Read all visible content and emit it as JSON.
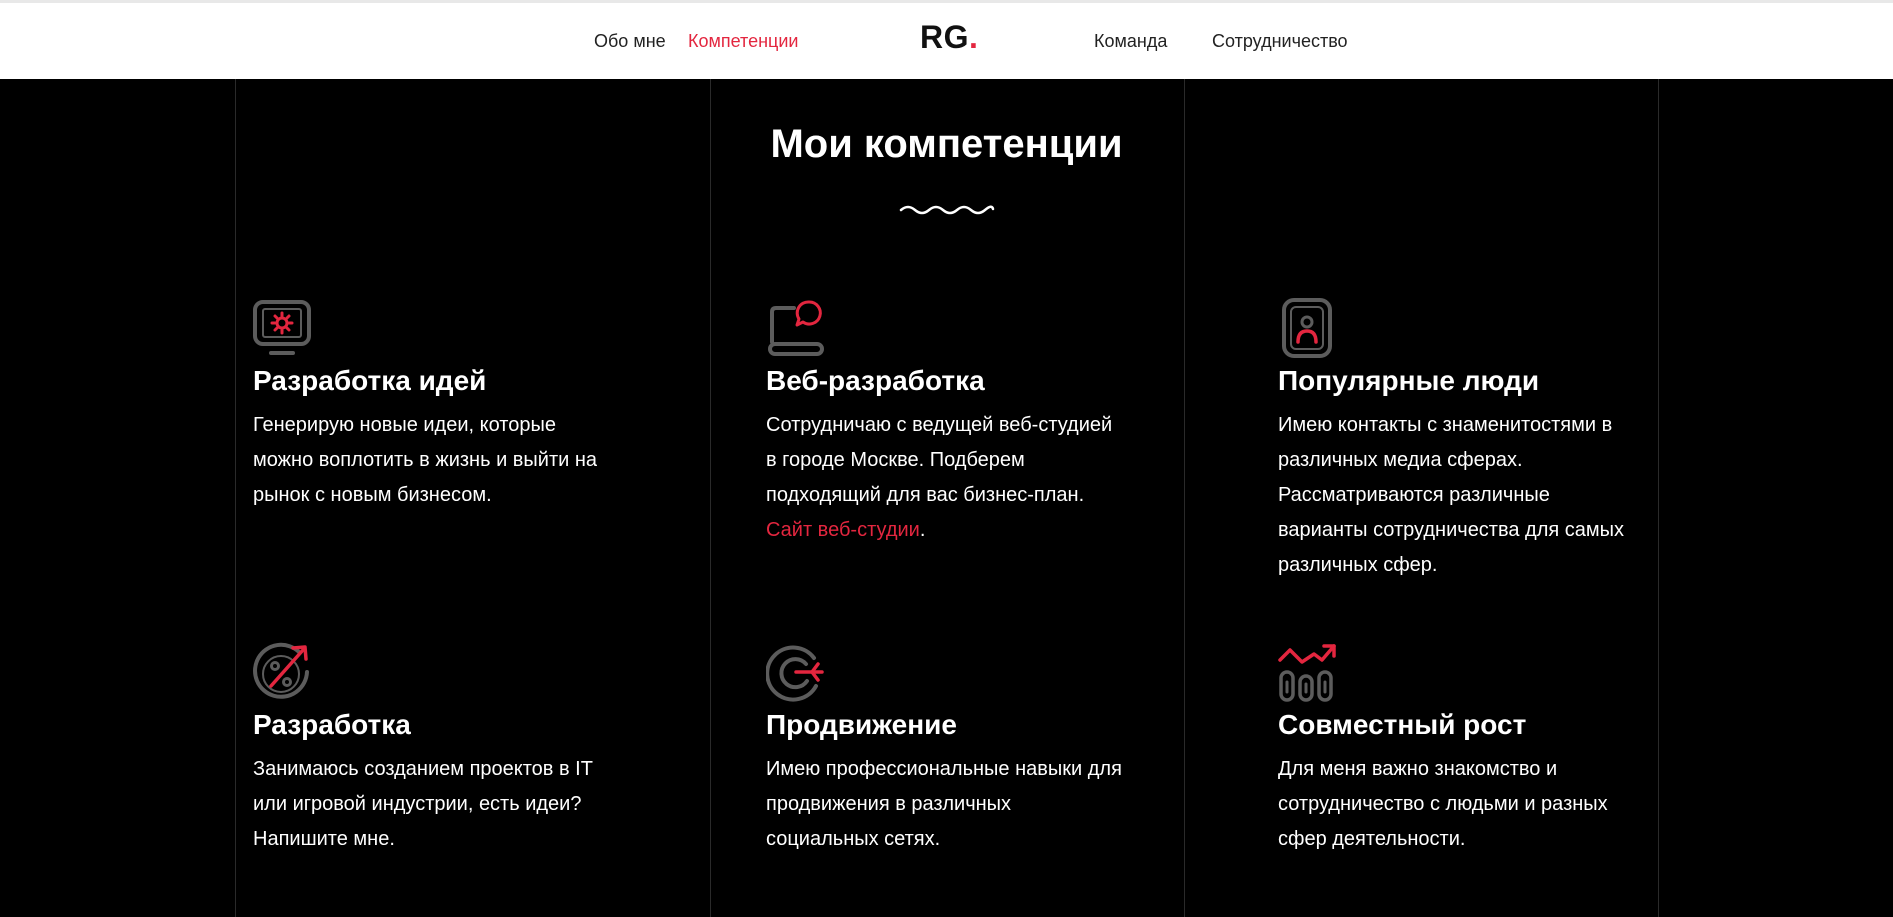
{
  "nav": {
    "about": "Обо мне",
    "competencies": "Компетенции",
    "logo_text": "RG",
    "logo_dot": ".",
    "team": "Команда",
    "cooperation": "Сотрудничество"
  },
  "section": {
    "title": "Мои компетенции"
  },
  "colors": {
    "accent": "#e3263f",
    "icon_gray": "#5c5c5c",
    "background": "#000000",
    "header_bg": "#ffffff"
  },
  "cards": [
    {
      "icon": "monitor-gear-icon",
      "title": "Разработка идей",
      "lines": [
        "Генерирую новые идеи, которые",
        "можно воплотить в жизнь и выйти на",
        "рынок с новым бизнесом."
      ]
    },
    {
      "icon": "laptop-chat-icon",
      "title": "Веб-разработка",
      "lines": [
        "Сотрудничаю с ведущей веб-студией",
        "в городе Москве. Подберем",
        "подходящий для вас бизнес-план."
      ],
      "link_text": "Сайт веб-студии",
      "link_suffix": "."
    },
    {
      "icon": "phone-person-icon",
      "title": "Популярные люди",
      "lines": [
        "Имею контакты с знаменитостями в",
        "различных медиа сферах.",
        "Рассматриваются различные",
        "варианты сотрудничества для самых",
        "различных сфер."
      ]
    },
    {
      "icon": "percent-arrow-icon",
      "title": "Разработка",
      "lines": [
        "Занимаюсь созданием проектов в IT",
        "или игровой индустрии, есть идеи?",
        "Напишите мне."
      ]
    },
    {
      "icon": "target-arrow-icon",
      "title": "Продвижение",
      "lines": [
        "Имею профессиональные навыки для",
        "продвижения в различных",
        "социальных сетях."
      ]
    },
    {
      "icon": "growth-chart-icon",
      "title": "Совместный рост",
      "lines": [
        "Для меня важно знакомство и",
        "сотрудничество с людьми и разных",
        "сфер деятельности."
      ]
    }
  ]
}
